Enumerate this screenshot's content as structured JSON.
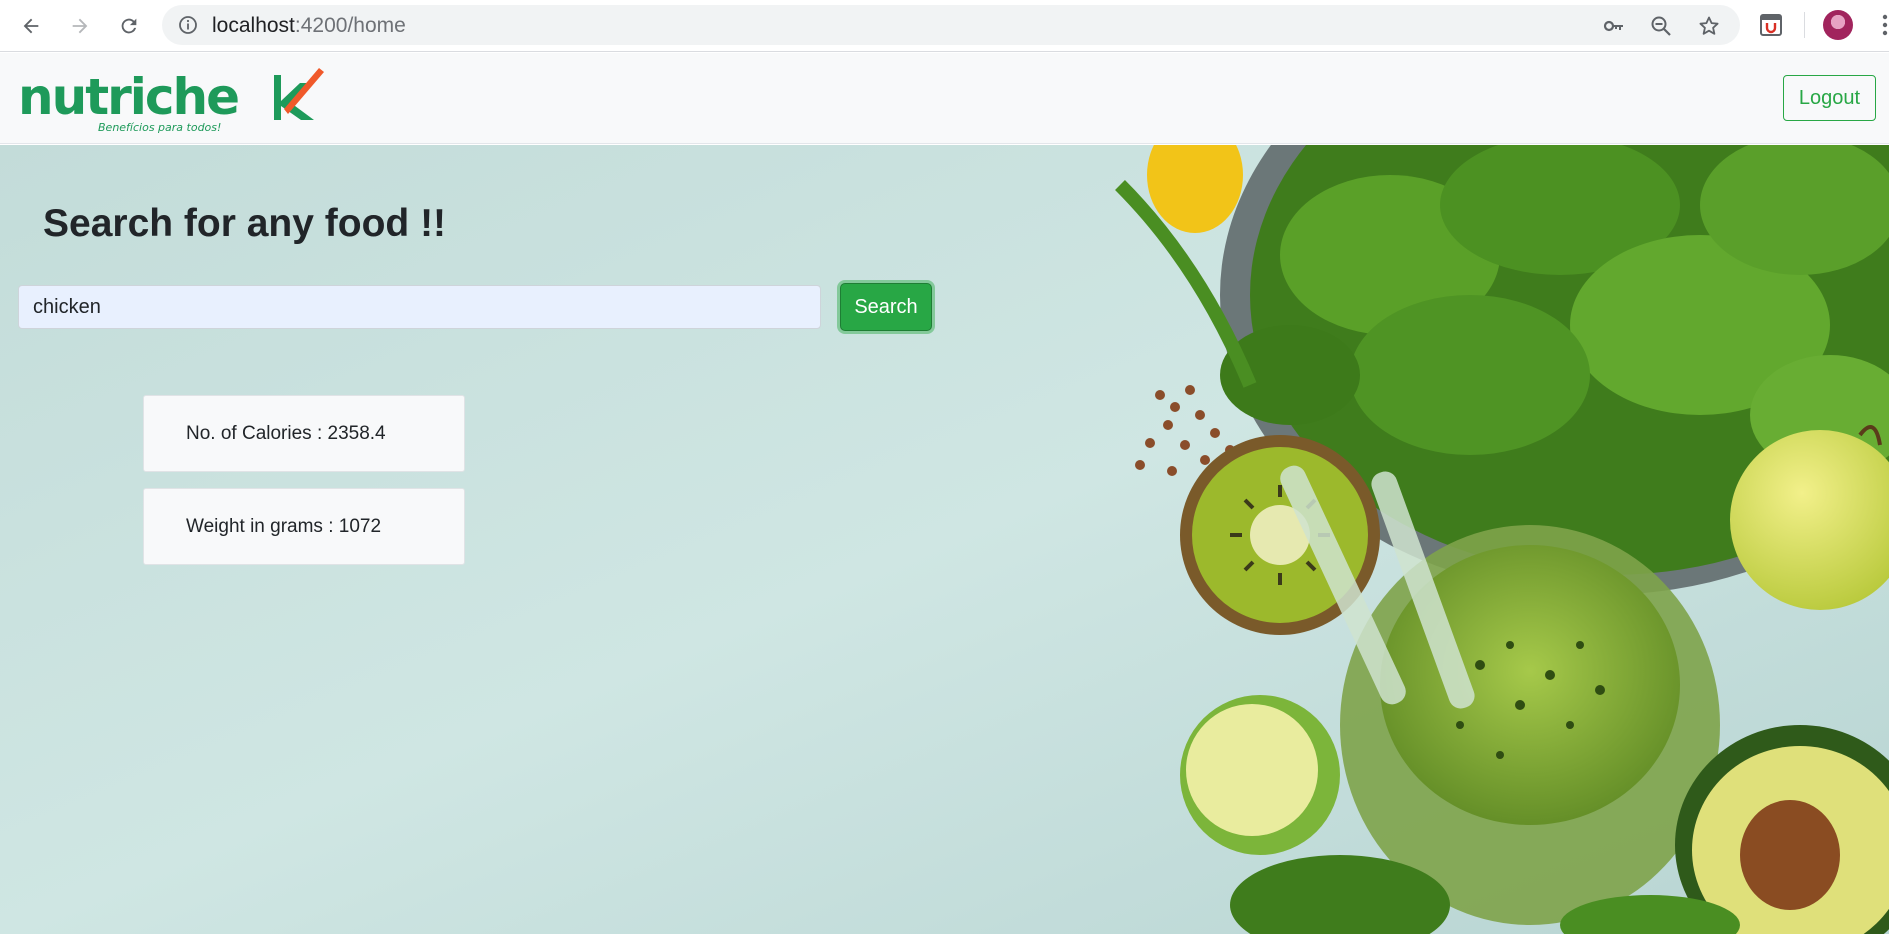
{
  "browser": {
    "url_host": "localhost",
    "url_path": ":4200/home",
    "icons": [
      "back-arrow-icon",
      "forward-arrow-icon",
      "reload-icon",
      "info-icon",
      "key-icon",
      "zoom-out-icon",
      "star-icon",
      "extension-icon",
      "profile-avatar",
      "menu-dots-icon"
    ]
  },
  "navbar": {
    "logo_text": "nutrichek",
    "logo_tagline": "Benefícios para todos!",
    "logout_label": "Logout"
  },
  "main": {
    "title": "Search for any food !!",
    "search": {
      "value": "chicken",
      "button_label": "Search"
    },
    "results": {
      "calories_text": "No. of Calories : 2358.4",
      "weight_text": "Weight in grams : 1072"
    }
  },
  "colors": {
    "brand_green": "#1e9a5a",
    "brand_orange": "#f0592a",
    "button_green": "#28a745"
  }
}
